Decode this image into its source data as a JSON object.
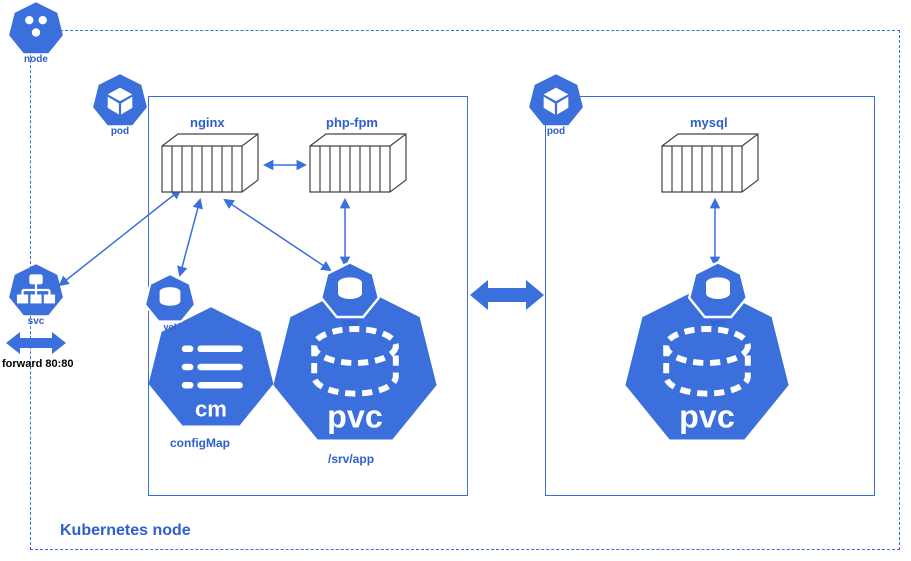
{
  "diagram_title": "Kubernetes node",
  "node": {
    "label": "node",
    "badge": "node"
  },
  "svc": {
    "label": "svc",
    "forward_label": "forward 80:80"
  },
  "pod1": {
    "badge_label": "pod",
    "containers": {
      "nginx": "nginx",
      "phpfpm": "php-fpm"
    },
    "vol_left": "vol",
    "vol_right": "vol",
    "cm_caption": "cm",
    "cm_sub": "configMap",
    "pvc_caption": "pvc",
    "pvc_sub": "/srv/app"
  },
  "pod2": {
    "badge_label": "pod",
    "containers": {
      "mysql": "mysql"
    },
    "vol": "vol",
    "pvc_caption": "pvc"
  }
}
